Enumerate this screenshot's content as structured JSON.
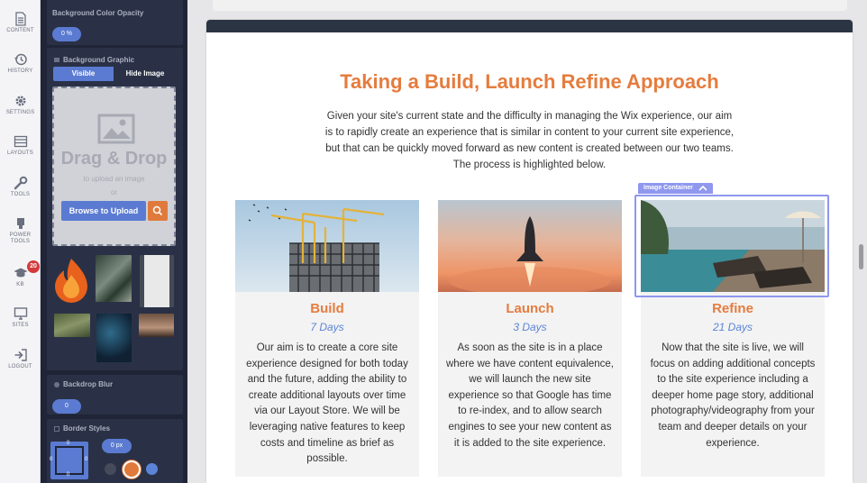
{
  "rail": {
    "items": [
      {
        "label": "CONTENT",
        "icon": "document-icon"
      },
      {
        "label": "HISTORY",
        "icon": "history-icon"
      },
      {
        "label": "SETTINGS",
        "icon": "gear-icon"
      },
      {
        "label": "LAYOUTS",
        "icon": "layouts-icon"
      },
      {
        "label": "TOOLS",
        "icon": "wrench-icon"
      },
      {
        "label": "POWER\nTOOLS",
        "icon": "power-tools-icon"
      },
      {
        "label": "KB",
        "icon": "graduation-cap-icon"
      },
      {
        "label": "SITES",
        "icon": "monitor-icon"
      },
      {
        "label": "LOGOUT",
        "icon": "logout-icon"
      }
    ],
    "kb_badge": "20"
  },
  "panel": {
    "bg_opacity": {
      "title": "Background Color Opacity",
      "value": "0 %"
    },
    "bg_graphic": {
      "title": "Background Graphic",
      "visible_label": "Visible",
      "hide_label": "Hide Image",
      "drop_title": "Drag & Drop",
      "drop_sub": "to upload an image",
      "drop_or": "or",
      "browse_label": "Browse to Upload"
    },
    "backdrop_blur": {
      "title": "Backdrop Blur",
      "value": "0"
    },
    "border_styles": {
      "title": "Border Styles",
      "value": "0 px",
      "corner_values": [
        "0",
        "0",
        "0",
        "0"
      ]
    }
  },
  "page": {
    "heading": "Taking a Build, Launch Refine Approach",
    "intro": "Given your site's current state and the difficulty in managing the Wix experience, our aim is to rapidly create an experience that is similar in content to your current site experience, but that can be quickly moved forward as new content is created between our two teams. The process is highlighted below.",
    "selection_label": "Image Container",
    "columns": [
      {
        "title": "Build",
        "days": "7 Days",
        "text": "Our aim is to create a core site experience designed for both today and the future, adding the ability to create additional layouts over time via our Layout Store. We will be leveraging native features to keep costs and timeline as brief as possible."
      },
      {
        "title": "Launch",
        "days": "3 Days",
        "text": "As soon as the site is in a place where we have content equivalence, we will launch the new site experience so that Google has time to re-index, and to allow search engines to see your new content as it is added to the site experience."
      },
      {
        "title": "Refine",
        "days": "21 Days",
        "text": "Now that the site is live, we will focus on adding additional concepts to the site experience including a deeper home page story, additional photography/videography from your team and deeper details on your experience."
      }
    ]
  },
  "colors": {
    "accent_orange": "#e57c3e",
    "accent_blue": "#5b7bd2",
    "panel_dark": "#1f2536",
    "selection": "#8f97ee"
  }
}
